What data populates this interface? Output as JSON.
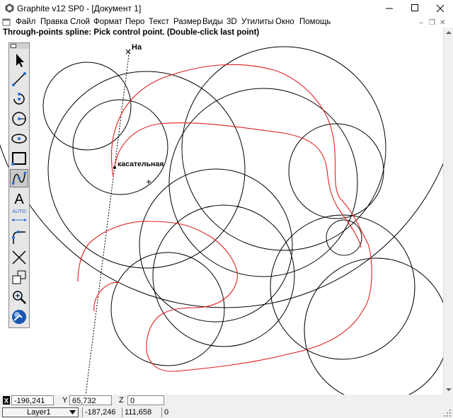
{
  "window": {
    "title": "Graphite v12 SP0 - [Документ 1]"
  },
  "menu": [
    "Файл",
    "Правка",
    "Слой",
    "Формат",
    "Перо",
    "Текст",
    "Размер",
    "Виды",
    "3D",
    "Утилиты",
    "Окно",
    "Помощь"
  ],
  "prompt": "Through-points spline: Pick control point. (Double-click last point)",
  "canvas": {
    "label_top": "На",
    "label_tangent": "касательная"
  },
  "toolbar": {
    "auto_label": "AUTO"
  },
  "coords": {
    "x_value": "-196,241",
    "y_label": "Y",
    "y_value": "65,732",
    "z_label": "Z",
    "z_value": "0"
  },
  "layerbar": {
    "layer": "Layer1",
    "v1": "-187,246",
    "v2": "111,658",
    "v3": "0"
  },
  "colors": {
    "spline": "#e02020",
    "geometry": "#000000",
    "active_tool": "#c8c8c8"
  }
}
